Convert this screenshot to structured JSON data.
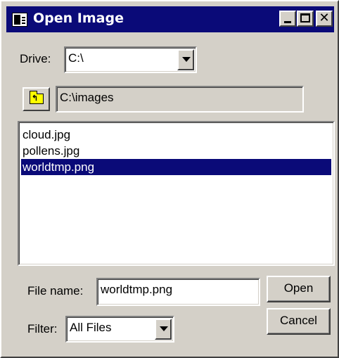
{
  "window": {
    "title": "Open Image",
    "title_icon": "dialog-icon",
    "controls": [
      "minimize",
      "maximize",
      "close"
    ],
    "close_glyph": "✕"
  },
  "drive": {
    "label": "Drive:",
    "value": "C:\\"
  },
  "folder": {
    "up_icon": "folder-up-icon",
    "path": "C:\\images"
  },
  "files": [
    {
      "name": "cloud.jpg",
      "selected": false
    },
    {
      "name": "pollens.jpg",
      "selected": false
    },
    {
      "name": "worldtmp.png",
      "selected": true
    }
  ],
  "file_name": {
    "label": "File name:",
    "value": "worldtmp.png"
  },
  "filter": {
    "label": "Filter:",
    "value": "All Files"
  },
  "buttons": {
    "open": "Open",
    "cancel": "Cancel"
  },
  "colors": {
    "title_bar": "#0a0a78",
    "selection": "#0a0a78",
    "face": "#d4d0c8"
  }
}
